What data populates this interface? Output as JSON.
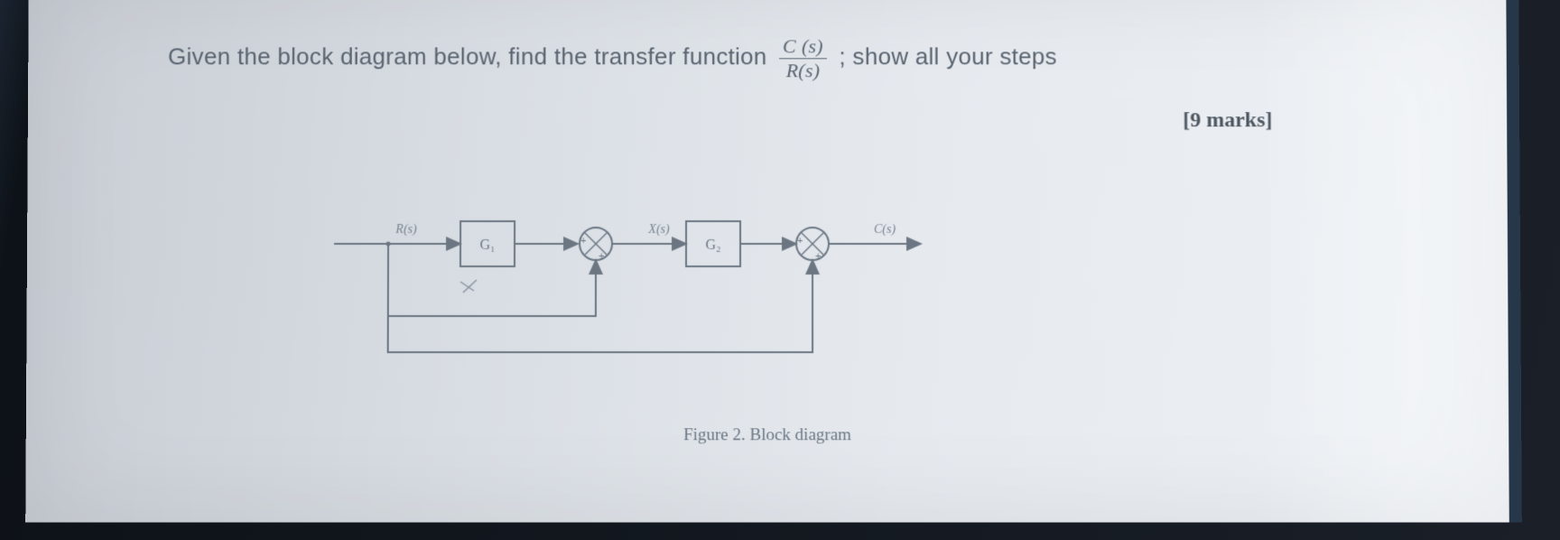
{
  "question": {
    "prefix": "Given the block diagram below, find the transfer function ",
    "frac_num": "C (s)",
    "frac_den": "R(s)",
    "suffix": "; show all your steps"
  },
  "marks": "[9 marks]",
  "diagram": {
    "caption": "Figure 2. Block diagram",
    "input_label": "R(s)",
    "block1": "G₁",
    "mid_label": "X(s)",
    "block2": "G₂",
    "output_label": "C(s)"
  }
}
